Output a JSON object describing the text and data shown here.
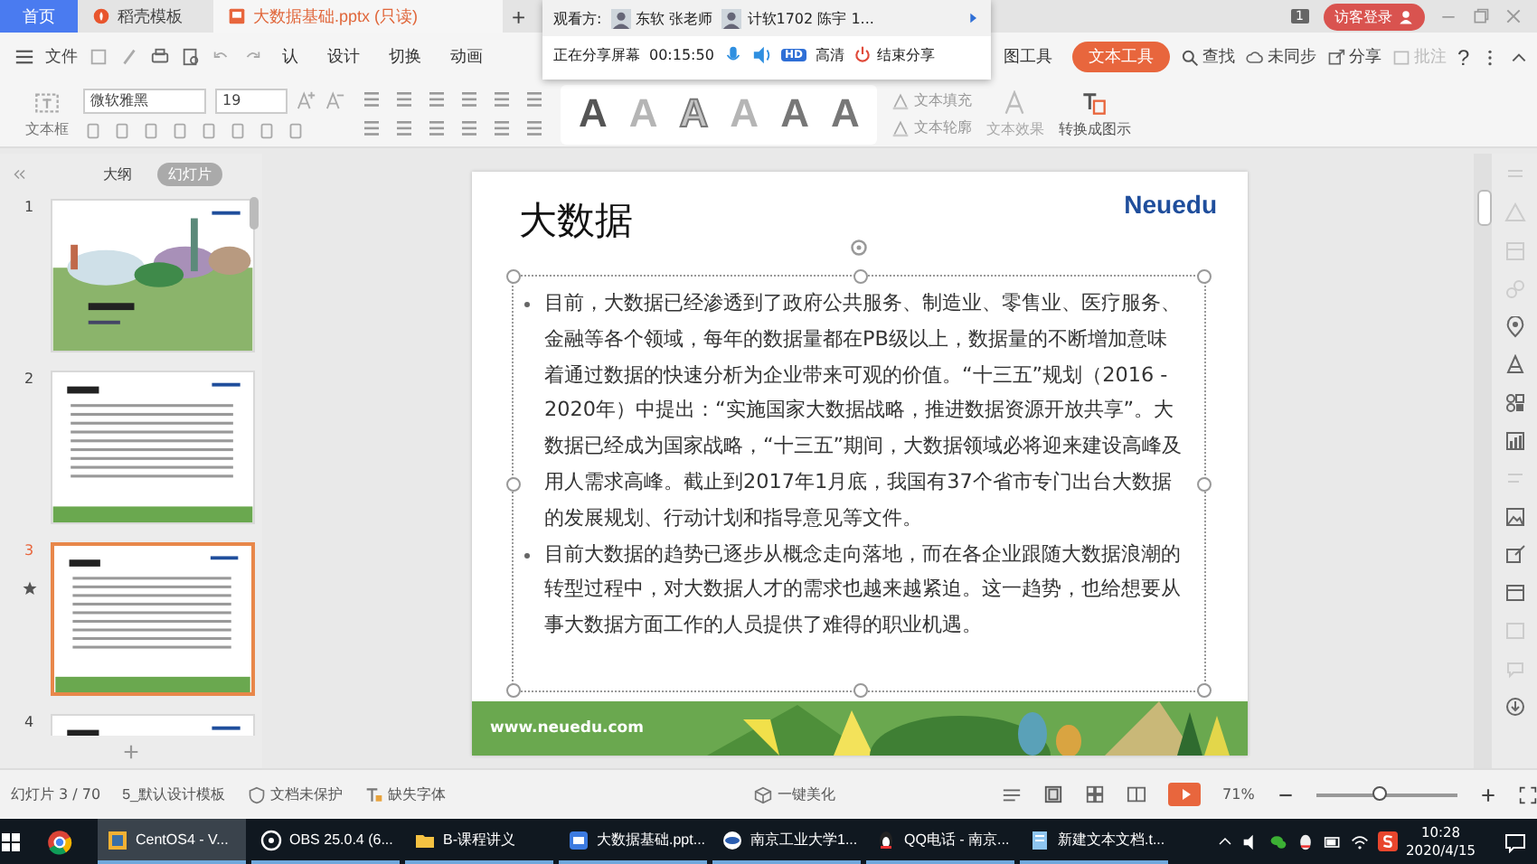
{
  "tabs": [
    {
      "label": "首页",
      "kind": "home",
      "selected": false
    },
    {
      "label": "稻壳模板",
      "kind": "template",
      "selected": false
    },
    {
      "label": "大数据基础.pptx (只读)",
      "kind": "document",
      "selected": true
    }
  ],
  "new_tab": "+",
  "share_panel": {
    "viewers_label": "观看方:",
    "viewers": [
      {
        "name": "东软 张老师"
      },
      {
        "name": "计软1702 陈宇 1..."
      }
    ],
    "status": "正在分享屏幕",
    "time": "00:15:50",
    "quality_badge": "HD",
    "quality": "高清",
    "end_button": "结束分享"
  },
  "title_bar": {
    "badge": "1",
    "login_button": "访客登录"
  },
  "menu": {
    "file": "文件",
    "tabs": [
      {
        "label": "认",
        "selected": false
      },
      {
        "label": "设计",
        "selected": false
      },
      {
        "label": "切换",
        "selected": false
      },
      {
        "label": "动画",
        "selected": false
      },
      {
        "label": "图工具",
        "selected": false
      },
      {
        "label": "文本工具",
        "selected": true
      }
    ],
    "search": "查找",
    "sync": "未同步",
    "share": "分享",
    "comment": "批注",
    "help": "?"
  },
  "toolbar": {
    "textbox": "文本框",
    "font": "微软雅黑",
    "size": "19",
    "text_styles": [
      {
        "label": "A",
        "kind": "dark"
      },
      {
        "label": "A",
        "kind": "light"
      },
      {
        "label": "A",
        "kind": "outline"
      },
      {
        "label": "A",
        "kind": "light"
      },
      {
        "label": "A",
        "kind": "grey"
      },
      {
        "label": "A",
        "kind": "grey"
      }
    ],
    "text_fill": "文本填充",
    "text_outline": "文本轮廓",
    "text_effect": "文本效果",
    "convert": "转换成图示"
  },
  "panel_tabs": [
    {
      "label": "大纲",
      "selected": false
    },
    {
      "label": "幻灯片",
      "selected": true
    }
  ],
  "slides": [
    {
      "number": "1",
      "kind": "cover",
      "selected": false,
      "animated": false
    },
    {
      "number": "2",
      "kind": "text",
      "selected": false,
      "animated": false
    },
    {
      "number": "3",
      "kind": "text",
      "selected": true,
      "animated": true
    },
    {
      "number": "4",
      "kind": "text",
      "selected": false,
      "animated": false
    }
  ],
  "add_slide": "+",
  "slide": {
    "title": "大数据",
    "logo": "Neuedu",
    "bullets": [
      "目前，大数据已经渗透到了政府公共服务、制造业、零售业、医疗服务、金融等各个领域，每年的数据量都在PB级以上，数据量的不断增加意味着通过数据的快速分析为企业带来可观的价值。“十三五”规划（2016 - 2020年）中提出：“实施国家大数据战略，推进数据资源开放共享”。大数据已经成为国家战略，“十三五”期间，大数据领域必将迎来建设高峰及用人需求高峰。截止到2017年1月底，我国有37个省市专门出台大数据的发展规划、行动计划和指导意见等文件。",
      "目前大数据的趋势已逐步从概念走向落地，而在各企业跟随大数据浪潮的转型过程中，对大数据人才的需求也越来越紧迫。这一趋势，也给想要从事大数据方面工作的人员提供了难得的职业机遇。"
    ],
    "footer": "www.neuedu.com"
  },
  "status_bar": {
    "slide_count": "幻灯片 3 / 70",
    "template": "5_默认设计模板",
    "protection": "文档未保护",
    "missing_fonts": "缺失字体",
    "beautify": "一键美化",
    "zoom": "71%",
    "zoom_slider": {
      "level": 0.45
    }
  },
  "taskbar": {
    "apps": [
      {
        "label": "CentOS4 - V...",
        "kind": "vm",
        "selected": true
      },
      {
        "label": "OBS 25.0.4 (6...",
        "kind": "obs",
        "selected": false
      },
      {
        "label": "B-课程讲义",
        "kind": "folder",
        "selected": false
      },
      {
        "label": "大数据基础.ppt...",
        "kind": "slides",
        "selected": false
      },
      {
        "label": "南京工业大学1...",
        "kind": "meeting",
        "selected": false
      },
      {
        "label": "QQ电话 - 南京...",
        "kind": "qq",
        "selected": false
      },
      {
        "label": "新建文本文档.t...",
        "kind": "notepad",
        "selected": false
      }
    ],
    "time": "10:28",
    "date": "2020/4/15"
  }
}
